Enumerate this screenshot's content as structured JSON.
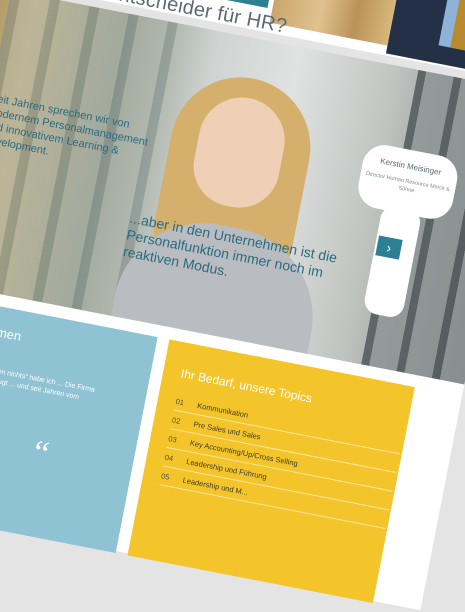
{
  "page": {
    "title": "Sie sind Entscheider für HR?"
  },
  "hero": {
    "intro_text": "Seit Jahren sprechen wir von modernem Personalmanagement und innovativem Learning & Development.",
    "quote_text": "...aber in den Unternehmen ist die Personalfunktion immer noch im reaktiven Modus.",
    "person_name": "Kerstin Meisinger",
    "person_role": "Director Human Resource Merck & Söhne",
    "next_icon": "chevron-right-icon",
    "next_symbol": "›"
  },
  "testimonials": {
    "title": "Kundenstimmen",
    "text": "Aussage „Trainings bringen nichts“ habe ich ... Die Firma Brenner & Partner überzeugt ... und seit Jahren vom Gegenteil!",
    "quote_mark": "“"
  },
  "topics": {
    "title": "Ihr Bedarf, unsere Topics",
    "items": [
      {
        "num": "01",
        "label": "Kommunikation"
      },
      {
        "num": "02",
        "label": "Pre Sales und Sales"
      },
      {
        "num": "03",
        "label": "Key Accounting/Up/Cross Selling"
      },
      {
        "num": "04",
        "label": "Leadership und Führung"
      },
      {
        "num": "05",
        "label": "Leadership und M..."
      }
    ]
  },
  "colors": {
    "teal": "#2d7f93",
    "light_blue": "#8fc2d3",
    "yellow": "#f3c52b",
    "text_blue": "#2b6b80"
  }
}
